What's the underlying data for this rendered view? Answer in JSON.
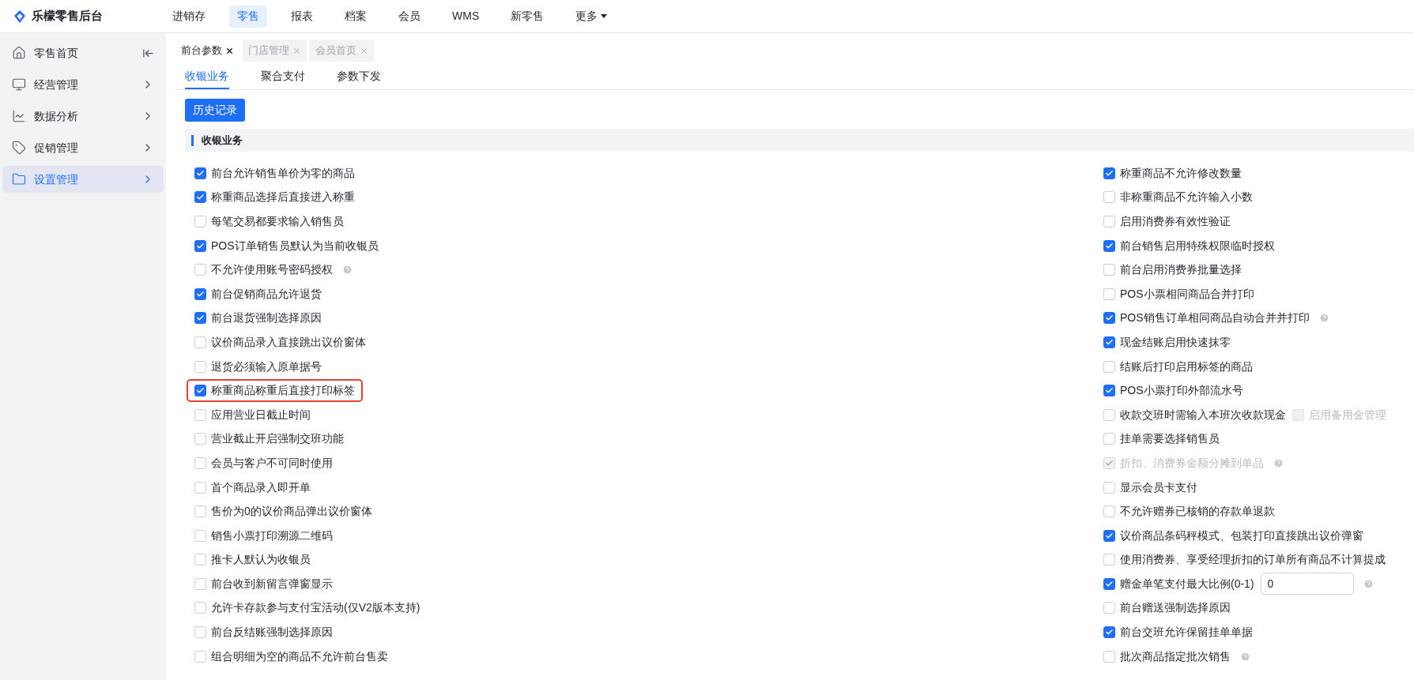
{
  "app": {
    "title": "乐檬零售后台"
  },
  "top_nav": [
    {
      "label": "进销存",
      "selected": false
    },
    {
      "label": "零售",
      "selected": true
    },
    {
      "label": "报表",
      "selected": false
    },
    {
      "label": "档案",
      "selected": false
    },
    {
      "label": "会员",
      "selected": false
    },
    {
      "label": "WMS",
      "selected": false
    },
    {
      "label": "新零售",
      "selected": false
    },
    {
      "label": "更多",
      "selected": false,
      "dropdown": true
    }
  ],
  "sidebar": {
    "items": [
      {
        "label": "零售首页",
        "selected": false
      },
      {
        "label": "经营管理",
        "selected": false
      },
      {
        "label": "数据分析",
        "selected": false
      },
      {
        "label": "促销管理",
        "selected": false
      },
      {
        "label": "设置管理",
        "selected": true
      }
    ]
  },
  "page_tabs": [
    {
      "label": "前台参数",
      "selected": true
    },
    {
      "label": "门店管理",
      "selected": false
    },
    {
      "label": "会员首页",
      "selected": false
    }
  ],
  "sub_tabs": [
    {
      "label": "收银业务",
      "selected": true
    },
    {
      "label": "聚合支付",
      "selected": false
    },
    {
      "label": "参数下发",
      "selected": false
    }
  ],
  "history_button": "历史记录",
  "section": {
    "title": "收银业务"
  },
  "left_options": [
    {
      "label": "前台允许销售单价为零的商品",
      "checked": true
    },
    {
      "label": "称重商品选择后直接进入称重",
      "checked": true
    },
    {
      "label": "每笔交易都要求输入销售员",
      "checked": false
    },
    {
      "label": "POS订单销售员默认为当前收银员",
      "checked": true
    },
    {
      "label": "不允许使用账号密码授权",
      "checked": false,
      "help": true
    },
    {
      "label": "前台促销商品允许退货",
      "checked": true
    },
    {
      "label": "前台退货强制选择原因",
      "checked": true
    },
    {
      "label": "议价商品录入直接跳出议价窗体",
      "checked": false
    },
    {
      "label": "退货必须输入原单据号",
      "checked": false
    },
    {
      "label": "称重商品称重后直接打印标签",
      "checked": true,
      "highlighted": true
    },
    {
      "label": "应用营业日截止时间",
      "checked": false
    },
    {
      "label": "营业截止开启强制交班功能",
      "checked": false
    },
    {
      "label": "会员与客户不可同时使用",
      "checked": false
    },
    {
      "label": "首个商品录入即开单",
      "checked": false
    },
    {
      "label": "售价为0的议价商品弹出议价窗体",
      "checked": false
    },
    {
      "label": "销售小票打印溯源二维码",
      "checked": false
    },
    {
      "label": "推卡人默认为收银员",
      "checked": false
    },
    {
      "label": "前台收到新留言弹窗显示",
      "checked": false
    },
    {
      "label": "允许卡存款参与支付宝活动(仅V2版本支持)",
      "checked": false
    },
    {
      "label": "前台反结账强制选择原因",
      "checked": false
    },
    {
      "label": "组合明细为空的商品不允许前台售卖",
      "checked": false
    }
  ],
  "right_options": [
    {
      "label": "称重商品不允许修改数量",
      "checked": true
    },
    {
      "label": "非称重商品不允许输入小数",
      "checked": false
    },
    {
      "label": "启用消费券有效性验证",
      "checked": false
    },
    {
      "label": "前台销售启用特殊权限临时授权",
      "checked": true
    },
    {
      "label": "前台启用消费券批量选择",
      "checked": false
    },
    {
      "label": "POS小票相同商品合并打印",
      "checked": false
    },
    {
      "label": "POS销售订单相同商品自动合并并打印",
      "checked": true,
      "help": true
    },
    {
      "label": "现金结账启用快速抹零",
      "checked": true
    },
    {
      "label": "结账后打印启用标签的商品",
      "checked": false
    },
    {
      "label": "POS小票打印外部流水号",
      "checked": true
    },
    {
      "label": "收款交班时需输入本班次收款现金",
      "checked": false,
      "extra": {
        "label": "启用备用金管理",
        "checked": false,
        "disabled": true
      }
    },
    {
      "label": "挂单需要选择销售员",
      "checked": false
    },
    {
      "label": "折扣、消费券金额分摊到单品",
      "checked": true,
      "disabled": true,
      "help": true
    },
    {
      "label": "显示会员卡支付",
      "checked": false
    },
    {
      "label": "不允许赠券已核销的存款单退款",
      "checked": false
    },
    {
      "label": "议价商品条码秤模式、包装打印直接跳出议价弹窗",
      "checked": true
    },
    {
      "label": "使用消费券、享受经理折扣的订单所有商品不计算提成",
      "checked": false
    },
    {
      "label": "赠金单笔支付最大比例(0-1)",
      "checked": true,
      "input": {
        "value": "0"
      },
      "help": true
    },
    {
      "label": "前台赠送强制选择原因",
      "checked": false
    },
    {
      "label": "前台交班允许保留挂单单据",
      "checked": true
    },
    {
      "label": "批次商品指定批次销售",
      "checked": false,
      "help": true
    }
  ]
}
